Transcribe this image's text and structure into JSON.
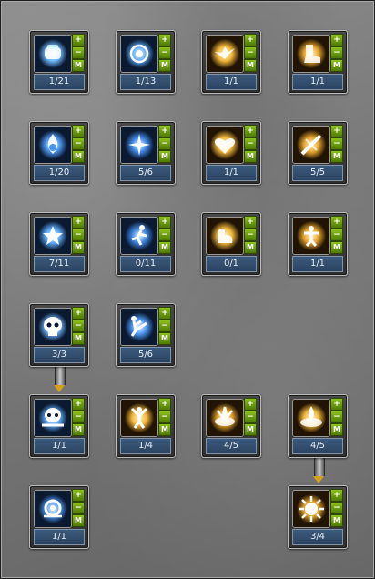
{
  "buttons": {
    "plus": "+",
    "minus": "−",
    "max": "M"
  },
  "colors": {
    "frost_glow": "#6fb8ff",
    "gold_glow": "#f3b83a",
    "button_green": "#6fa811",
    "level_bar": "#34506f"
  },
  "skills": [
    {
      "id": "s1",
      "level": "1/21",
      "icon": "ice-fist-icon",
      "theme": "frost"
    },
    {
      "id": "s2",
      "level": "1/13",
      "icon": "spinning-disc-icon",
      "theme": "frost"
    },
    {
      "id": "s3",
      "level": "1/1",
      "icon": "golden-bird-icon",
      "theme": "gold"
    },
    {
      "id": "s4",
      "level": "1/1",
      "icon": "golden-boot-icon",
      "theme": "gold"
    },
    {
      "id": "s5",
      "level": "1/20",
      "icon": "flame-orb-icon",
      "theme": "frost"
    },
    {
      "id": "s6",
      "level": "5/6",
      "icon": "sparkle-burst-icon",
      "theme": "frost"
    },
    {
      "id": "s7",
      "level": "1/1",
      "icon": "air-heart-icon",
      "theme": "gold"
    },
    {
      "id": "s8",
      "level": "5/5",
      "icon": "golden-slash-icon",
      "theme": "gold"
    },
    {
      "id": "s9",
      "level": "7/11",
      "icon": "star-hands-icon",
      "theme": "frost"
    },
    {
      "id": "s10",
      "level": "0/11",
      "icon": "running-figure-icon",
      "theme": "frost"
    },
    {
      "id": "s11",
      "level": "0/1",
      "icon": "flexed-arm-icon",
      "theme": "gold"
    },
    {
      "id": "s12",
      "level": "1/1",
      "icon": "radiant-figure-icon",
      "theme": "gold"
    },
    {
      "id": "s13",
      "level": "3/3",
      "icon": "skull-icon",
      "theme": "frost"
    },
    {
      "id": "s14",
      "level": "5/6",
      "icon": "kick-icon",
      "theme": "frost"
    },
    {
      "id": "s15",
      "level": "1/1",
      "icon": "frost-skull-burst-icon",
      "theme": "frost"
    },
    {
      "id": "s16",
      "level": "1/4",
      "icon": "golden-warrior-icon",
      "theme": "gold"
    },
    {
      "id": "s17",
      "level": "4/5",
      "icon": "golden-burst-icon",
      "theme": "gold"
    },
    {
      "id": "s18",
      "level": "4/5",
      "icon": "golden-eruption-icon",
      "theme": "gold"
    },
    {
      "id": "s19",
      "level": "1/1",
      "icon": "frost-orb-burst-icon",
      "theme": "frost"
    },
    {
      "id": "s20",
      "level": "3/4",
      "icon": "golden-nova-icon",
      "theme": "gold"
    }
  ],
  "links": [
    {
      "from": "s13",
      "to": "s15"
    },
    {
      "from": "s18",
      "to": "s20"
    }
  ]
}
